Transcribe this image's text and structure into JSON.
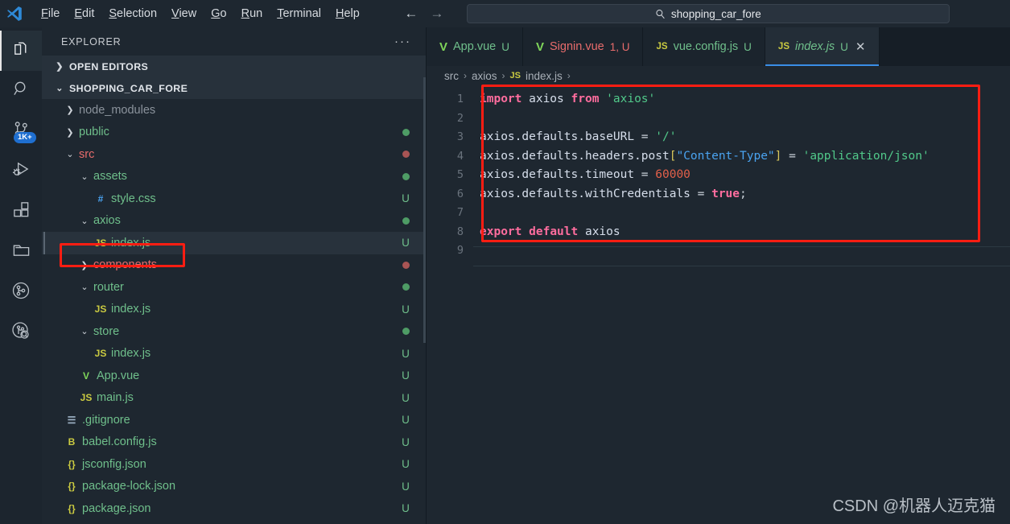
{
  "window": {
    "logo": "vscode-logo",
    "menu": [
      "File",
      "Edit",
      "Selection",
      "View",
      "Go",
      "Run",
      "Terminal",
      "Help"
    ],
    "nav_back": "←",
    "nav_forward": "→",
    "search": {
      "icon": "search-icon",
      "value": "shopping_car_fore"
    }
  },
  "activitybar": {
    "items": [
      {
        "name": "explorer",
        "icon": "files-icon",
        "active": true,
        "badge": ""
      },
      {
        "name": "search",
        "icon": "search-icon",
        "active": false,
        "badge": ""
      },
      {
        "name": "source-control",
        "icon": "source-control-icon",
        "active": false,
        "badge": "1K+"
      },
      {
        "name": "run-and-debug",
        "icon": "run-debug-icon",
        "active": false,
        "badge": ""
      },
      {
        "name": "extensions",
        "icon": "extensions-icon",
        "active": false,
        "badge": ""
      },
      {
        "name": "remote-explorer",
        "icon": "folder-icon",
        "active": false,
        "badge": ""
      },
      {
        "name": "gitlens",
        "icon": "gitlens-icon",
        "active": false,
        "badge": ""
      },
      {
        "name": "gitlens-inspect",
        "icon": "gitlens-inspect-icon",
        "active": false,
        "badge": ""
      }
    ]
  },
  "sidebar": {
    "title": "EXPLORER",
    "more_actions": "···",
    "sections": [
      {
        "label": "OPEN EDITORS",
        "expanded": false
      },
      {
        "label": "SHOPPING_CAR_FORE",
        "expanded": true
      }
    ],
    "tree": [
      {
        "label": "node_modules",
        "indent": 1,
        "type": "folder",
        "twisty": "collapsed",
        "color": "#8b939c",
        "status": "",
        "status_type": "none",
        "selected": false
      },
      {
        "label": "public",
        "indent": 1,
        "type": "folder",
        "twisty": "collapsed",
        "color": "#6fbf8b",
        "status": "",
        "status_type": "dot-green",
        "selected": false
      },
      {
        "label": "src",
        "indent": 1,
        "type": "folder",
        "twisty": "expanded",
        "color": "#e86c6c",
        "status": "",
        "status_type": "dot-red",
        "selected": false
      },
      {
        "label": "assets",
        "indent": 2,
        "type": "folder",
        "twisty": "expanded",
        "color": "#6fbf8b",
        "status": "",
        "status_type": "dot-green",
        "selected": false
      },
      {
        "label": "style.css",
        "indent": 3,
        "type": "file",
        "icon": "css-icon",
        "icon_glyph": "#",
        "icon_color": "#4aa3f0",
        "color": "#6fbf8b",
        "status": "U",
        "status_type": "letter",
        "selected": false
      },
      {
        "label": "axios",
        "indent": 2,
        "type": "folder",
        "twisty": "expanded",
        "color": "#6fbf8b",
        "status": "",
        "status_type": "dot-green",
        "selected": false
      },
      {
        "label": "index.js",
        "indent": 3,
        "type": "file",
        "icon": "js-icon",
        "icon_glyph": "JS",
        "icon_color": "#cbcb41",
        "color": "#6fbf8b",
        "status": "U",
        "status_type": "letter",
        "selected": true
      },
      {
        "label": "components",
        "indent": 2,
        "type": "folder",
        "twisty": "collapsed",
        "color": "#e86c6c",
        "status": "",
        "status_type": "dot-red",
        "selected": false
      },
      {
        "label": "router",
        "indent": 2,
        "type": "folder",
        "twisty": "expanded",
        "color": "#6fbf8b",
        "status": "",
        "status_type": "dot-green",
        "selected": false
      },
      {
        "label": "index.js",
        "indent": 3,
        "type": "file",
        "icon": "js-icon",
        "icon_glyph": "JS",
        "icon_color": "#cbcb41",
        "color": "#6fbf8b",
        "status": "U",
        "status_type": "letter",
        "selected": false
      },
      {
        "label": "store",
        "indent": 2,
        "type": "folder",
        "twisty": "expanded",
        "color": "#6fbf8b",
        "status": "",
        "status_type": "dot-green",
        "selected": false
      },
      {
        "label": "index.js",
        "indent": 3,
        "type": "file",
        "icon": "js-icon",
        "icon_glyph": "JS",
        "icon_color": "#cbcb41",
        "color": "#6fbf8b",
        "status": "U",
        "status_type": "letter",
        "selected": false
      },
      {
        "label": "App.vue",
        "indent": 2,
        "type": "file",
        "icon": "vue-icon",
        "icon_glyph": "V",
        "icon_color": "#7fd65a",
        "color": "#6fbf8b",
        "status": "U",
        "status_type": "letter",
        "selected": false
      },
      {
        "label": "main.js",
        "indent": 2,
        "type": "file",
        "icon": "js-icon",
        "icon_glyph": "JS",
        "icon_color": "#cbcb41",
        "color": "#6fbf8b",
        "status": "U",
        "status_type": "letter",
        "selected": false
      },
      {
        "label": ".gitignore",
        "indent": 1,
        "type": "file",
        "icon": "gitignore-icon",
        "icon_glyph": "☰",
        "icon_color": "#9fb4c7",
        "color": "#6fbf8b",
        "status": "U",
        "status_type": "letter",
        "selected": false
      },
      {
        "label": "babel.config.js",
        "indent": 1,
        "type": "file",
        "icon": "babel-icon",
        "icon_glyph": "B",
        "icon_color": "#cbcb41",
        "color": "#6fbf8b",
        "status": "U",
        "status_type": "letter",
        "selected": false
      },
      {
        "label": "jsconfig.json",
        "indent": 1,
        "type": "file",
        "icon": "json-icon",
        "icon_glyph": "{}",
        "icon_color": "#cbcb41",
        "color": "#6fbf8b",
        "status": "U",
        "status_type": "letter",
        "selected": false
      },
      {
        "label": "package-lock.json",
        "indent": 1,
        "type": "file",
        "icon": "json-icon",
        "icon_glyph": "{}",
        "icon_color": "#cbcb41",
        "color": "#6fbf8b",
        "status": "U",
        "status_type": "letter",
        "selected": false
      },
      {
        "label": "package.json",
        "indent": 1,
        "type": "file",
        "icon": "json-icon",
        "icon_glyph": "{}",
        "icon_color": "#cbcb41",
        "color": "#6fbf8b",
        "status": "U",
        "status_type": "letter",
        "selected": false
      }
    ]
  },
  "editor": {
    "tabs": [
      {
        "label": "App.vue",
        "icon": "vue-icon",
        "icon_glyph": "V",
        "icon_color": "#7fd65a",
        "badge": "U",
        "active": false,
        "error": false
      },
      {
        "label": "Signin.vue",
        "icon": "vue-icon",
        "icon_glyph": "V",
        "icon_color": "#7fd65a",
        "badge": "1, U",
        "active": false,
        "error": true
      },
      {
        "label": "vue.config.js",
        "icon": "js-icon",
        "icon_glyph": "JS",
        "icon_color": "#cbcb41",
        "badge": "U",
        "active": false,
        "error": false
      },
      {
        "label": "index.js",
        "icon": "js-icon",
        "icon_glyph": "JS",
        "icon_color": "#cbcb41",
        "badge": "U",
        "active": true,
        "error": false,
        "close": "✕"
      }
    ],
    "breadcrumb": [
      {
        "label": "src",
        "icon": ""
      },
      {
        "label": "axios",
        "icon": ""
      },
      {
        "label": "index.js",
        "icon": "JS"
      }
    ],
    "breadcrumb_separator": "›",
    "line_numbers": [
      "1",
      "2",
      "3",
      "4",
      "5",
      "6",
      "7",
      "8",
      "9"
    ],
    "code_lines": [
      [
        {
          "t": "import",
          "c": "kw"
        },
        {
          "t": " axios ",
          "c": "pl"
        },
        {
          "t": "from",
          "c": "kw"
        },
        {
          "t": " ",
          "c": "pl"
        },
        {
          "t": "'axios'",
          "c": "str"
        }
      ],
      [],
      [
        {
          "t": "axios.defaults.baseURL ",
          "c": "pl"
        },
        {
          "t": "=",
          "c": "op"
        },
        {
          "t": " ",
          "c": "pl"
        },
        {
          "t": "'/'",
          "c": "str"
        }
      ],
      [
        {
          "t": "axios.defaults.headers.post",
          "c": "pl"
        },
        {
          "t": "[",
          "c": "brk"
        },
        {
          "t": "\"Content-Type\"",
          "c": "str2"
        },
        {
          "t": "]",
          "c": "brk"
        },
        {
          "t": " ",
          "c": "pl"
        },
        {
          "t": "=",
          "c": "op"
        },
        {
          "t": " ",
          "c": "pl"
        },
        {
          "t": "'application/json'",
          "c": "str"
        }
      ],
      [
        {
          "t": "axios.defaults.timeout ",
          "c": "pl"
        },
        {
          "t": "=",
          "c": "op"
        },
        {
          "t": " ",
          "c": "pl"
        },
        {
          "t": "60000",
          "c": "num"
        }
      ],
      [
        {
          "t": "axios.defaults.withCredentials ",
          "c": "pl"
        },
        {
          "t": "=",
          "c": "op"
        },
        {
          "t": " ",
          "c": "pl"
        },
        {
          "t": "true",
          "c": "bool"
        },
        {
          "t": ";",
          "c": "op"
        }
      ],
      [],
      [
        {
          "t": "export",
          "c": "kw"
        },
        {
          "t": " ",
          "c": "pl"
        },
        {
          "t": "default",
          "c": "kw"
        },
        {
          "t": " axios",
          "c": "pl"
        }
      ],
      []
    ]
  },
  "annotations": [
    {
      "name": "code-block-highlight",
      "color": "#fd1d12"
    },
    {
      "name": "file-index-js-highlight",
      "color": "#fd1d12"
    }
  ],
  "watermark": "CSDN @机器人迈克猫"
}
